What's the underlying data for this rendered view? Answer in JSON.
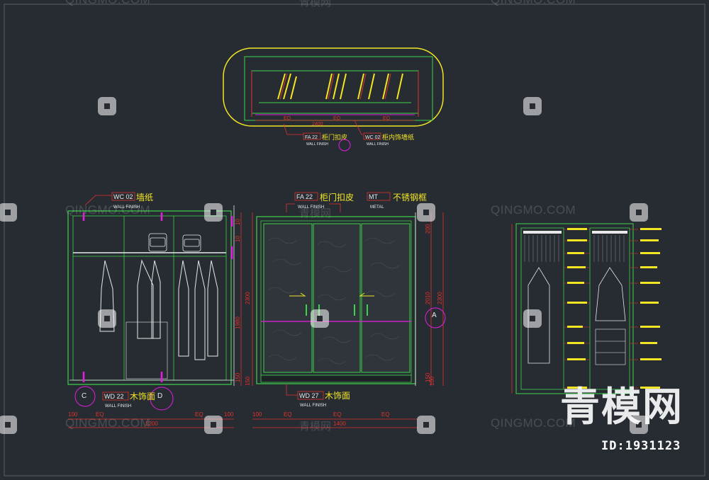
{
  "plan": {
    "label_fa": {
      "code": "FA 22",
      "cn": "柜门扣皮",
      "en": "WALL FINISH"
    },
    "label_wc": {
      "code": "WC 02",
      "cn": "柜内饰墙纸",
      "en": "WALL FINISH"
    },
    "dims": [
      "EQ",
      "EQ",
      "EQ",
      "2400"
    ]
  },
  "elev_c": {
    "top_label": {
      "code": "WC 02",
      "cn": "墙纸",
      "en": "WALL FINISH"
    },
    "bottom_label": {
      "code": "WD 22",
      "cn": "木饰面",
      "en": "WALL FINISH"
    },
    "markers": [
      "C",
      "D"
    ],
    "dims_bottom": [
      "100",
      "EQ",
      "EQ",
      "100",
      "1200"
    ]
  },
  "elev_a": {
    "top_label_fa": {
      "code": "FA 22",
      "cn": "柜门扣皮",
      "en": "WALL FINISH"
    },
    "top_label_mt": {
      "code": "MT",
      "cn": "不锈钢框",
      "en": "METAL"
    },
    "bottom_label": {
      "code": "WD 27",
      "cn": "木饰面",
      "en": "WALL FINISH"
    },
    "marker": "A",
    "dims_left": [
      "10",
      "10",
      "150",
      "1980",
      "2300",
      "150"
    ],
    "dims_right": [
      "200",
      "2010",
      "2300",
      "150",
      "100"
    ],
    "dims_bottom": [
      "100",
      "EQ",
      "EQ",
      "EQ",
      "1400"
    ]
  },
  "watermarks": {
    "en": "QINGMO.COM",
    "cn": "青模网"
  },
  "brand": "青模网",
  "image_id": "ID:1931123",
  "colors": {
    "bg": "#272c33",
    "green": "#3bd34a",
    "yellow": "#f2e524",
    "magenta": "#e21ee0",
    "red": "#e0322c",
    "cyan": "#36d6d6",
    "white": "#e8e8e8"
  }
}
